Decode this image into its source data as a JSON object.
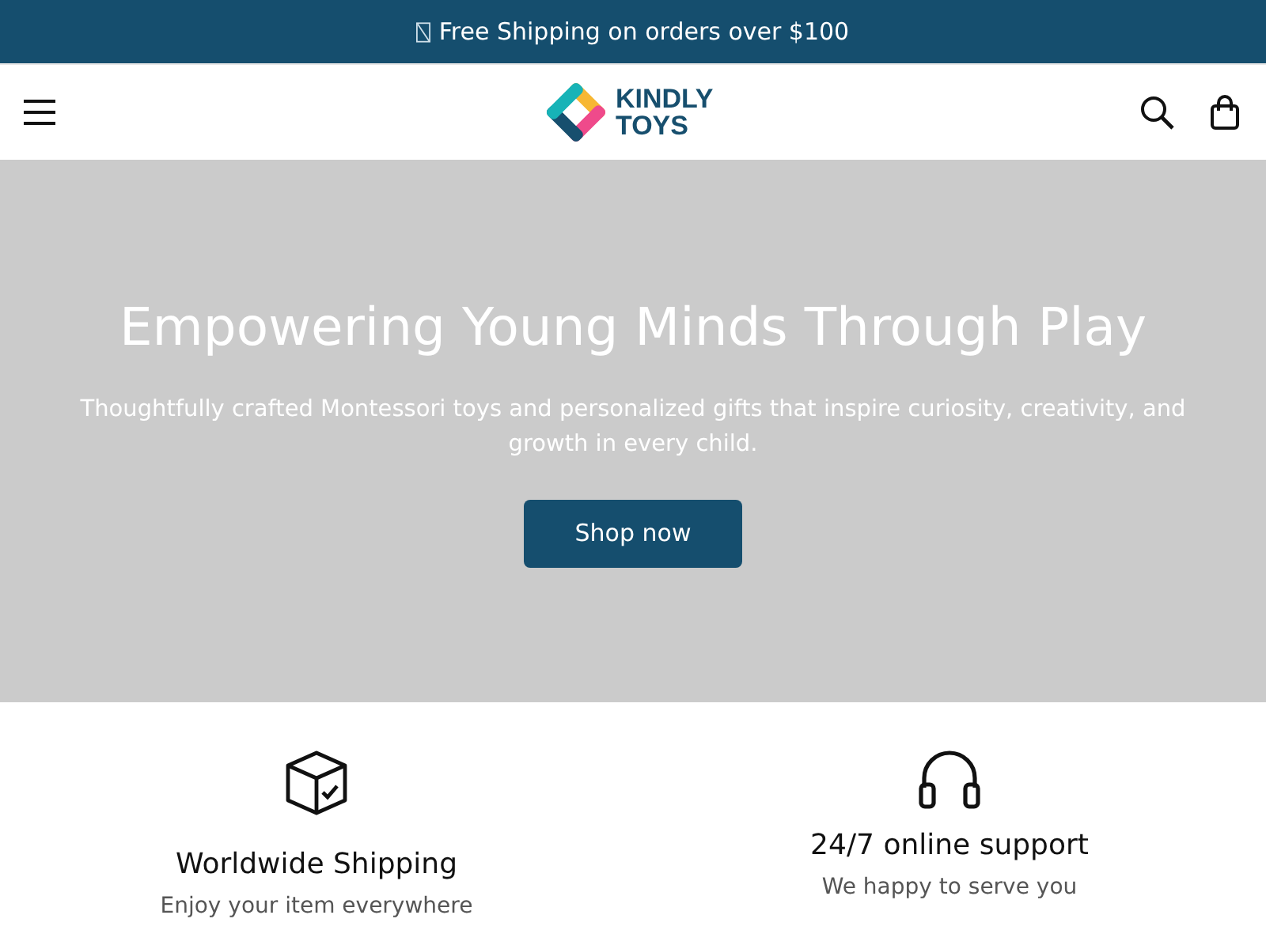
{
  "announcement": {
    "text": "Free Shipping on orders over $100"
  },
  "header": {
    "logo": {
      "line_1": "KINDLY",
      "line_2": "TOYS"
    }
  },
  "hero": {
    "title": "Empowering Young Minds Through Play",
    "subtitle": "Thoughtfully crafted Montessori toys and personalized gifts that inspire curiosity, creativity, and growth in every child.",
    "button": "Shop now"
  },
  "features": [
    {
      "kind": "box",
      "title": "Worldwide Shipping",
      "text": "Enjoy your item everywhere"
    },
    {
      "kind": "headphones",
      "title": "24/7 online support",
      "text": "We happy to serve you"
    }
  ]
}
